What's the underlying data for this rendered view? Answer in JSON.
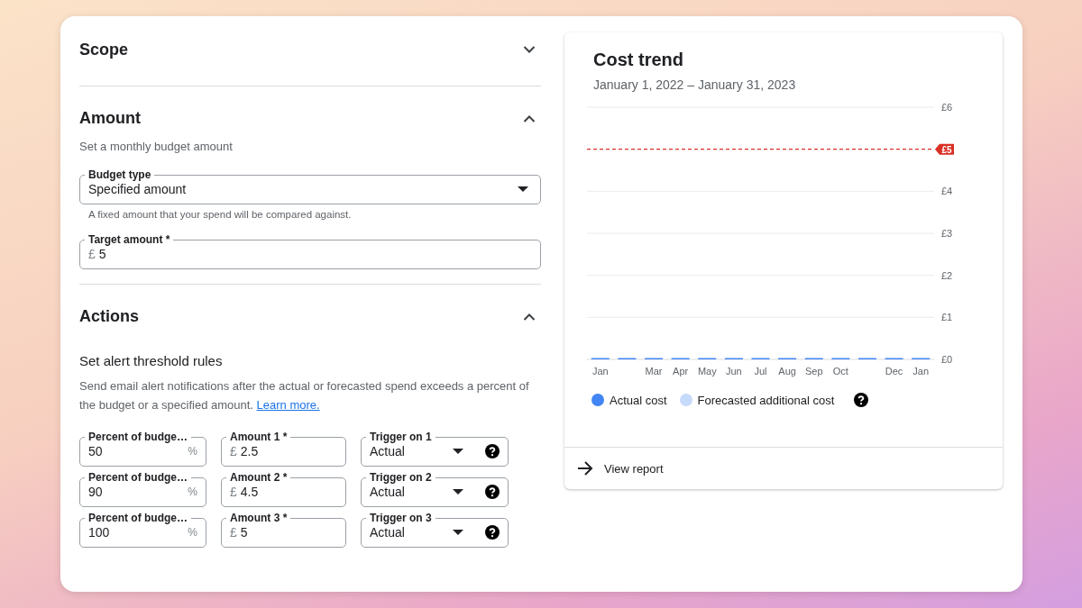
{
  "scope": {
    "title": "Scope",
    "expanded": false
  },
  "amount": {
    "title": "Amount",
    "expanded": true,
    "description": "Set a monthly budget amount",
    "budget_type": {
      "label": "Budget type",
      "value": "Specified amount",
      "helper": "A fixed amount that your spend will be compared against."
    },
    "target_amount": {
      "label": "Target amount *",
      "prefix": "£",
      "value": "5"
    }
  },
  "actions": {
    "title": "Actions",
    "expanded": true,
    "subtitle": "Set alert threshold rules",
    "description": "Send email alert notifications after the actual or forecasted spend exceeds a percent of the budget or a specified amount.",
    "link": "Learn more.",
    "rules": [
      {
        "percent_label": "Percent of budge…",
        "percent": "50",
        "percent_suffix": "%",
        "amount_label": "Amount 1 *",
        "amount_prefix": "£",
        "amount": "2.5",
        "trigger_label": "Trigger on 1",
        "trigger": "Actual"
      },
      {
        "percent_label": "Percent of budge…",
        "percent": "90",
        "percent_suffix": "%",
        "amount_label": "Amount 2 *",
        "amount_prefix": "£",
        "amount": "4.5",
        "trigger_label": "Trigger on 2",
        "trigger": "Actual"
      },
      {
        "percent_label": "Percent of budge…",
        "percent": "100",
        "percent_suffix": "%",
        "amount_label": "Amount 3 *",
        "amount_prefix": "£",
        "amount": "5",
        "trigger_label": "Trigger on 3",
        "trigger": "Actual"
      }
    ]
  },
  "cost_trend": {
    "title": "Cost trend",
    "date_range": "January 1, 2022 – January 31, 2023",
    "chart_data": {
      "type": "bar",
      "categories": [
        "Jan",
        null,
        "Mar",
        "Apr",
        "May",
        "Jun",
        "Jul",
        "Aug",
        "Sep",
        "Oct",
        null,
        "Dec",
        "Jan"
      ],
      "ylim": [
        0,
        6
      ],
      "yticks": [
        {
          "value": 0,
          "label": "£0"
        },
        {
          "value": 1,
          "label": "£1"
        },
        {
          "value": 2,
          "label": "£2"
        },
        {
          "value": 3,
          "label": "£3"
        },
        {
          "value": 4,
          "label": "£4"
        },
        {
          "value": 6,
          "label": "£6"
        }
      ],
      "series": [
        {
          "name": "Actual cost",
          "color": "#4285f4",
          "values": [
            0,
            0,
            0,
            0,
            0,
            0,
            0,
            0,
            0,
            0,
            0,
            0,
            0
          ]
        },
        {
          "name": "Forecasted additional cost",
          "color": "#c6dafc",
          "values": [
            null,
            null,
            null,
            null,
            null,
            null,
            null,
            null,
            null,
            null,
            null,
            null,
            null
          ]
        }
      ],
      "grid": true,
      "ref_lines": [
        {
          "axis": "y",
          "value": 5,
          "label": "£5",
          "color": "#d93025"
        }
      ]
    },
    "view_report": "View report"
  }
}
